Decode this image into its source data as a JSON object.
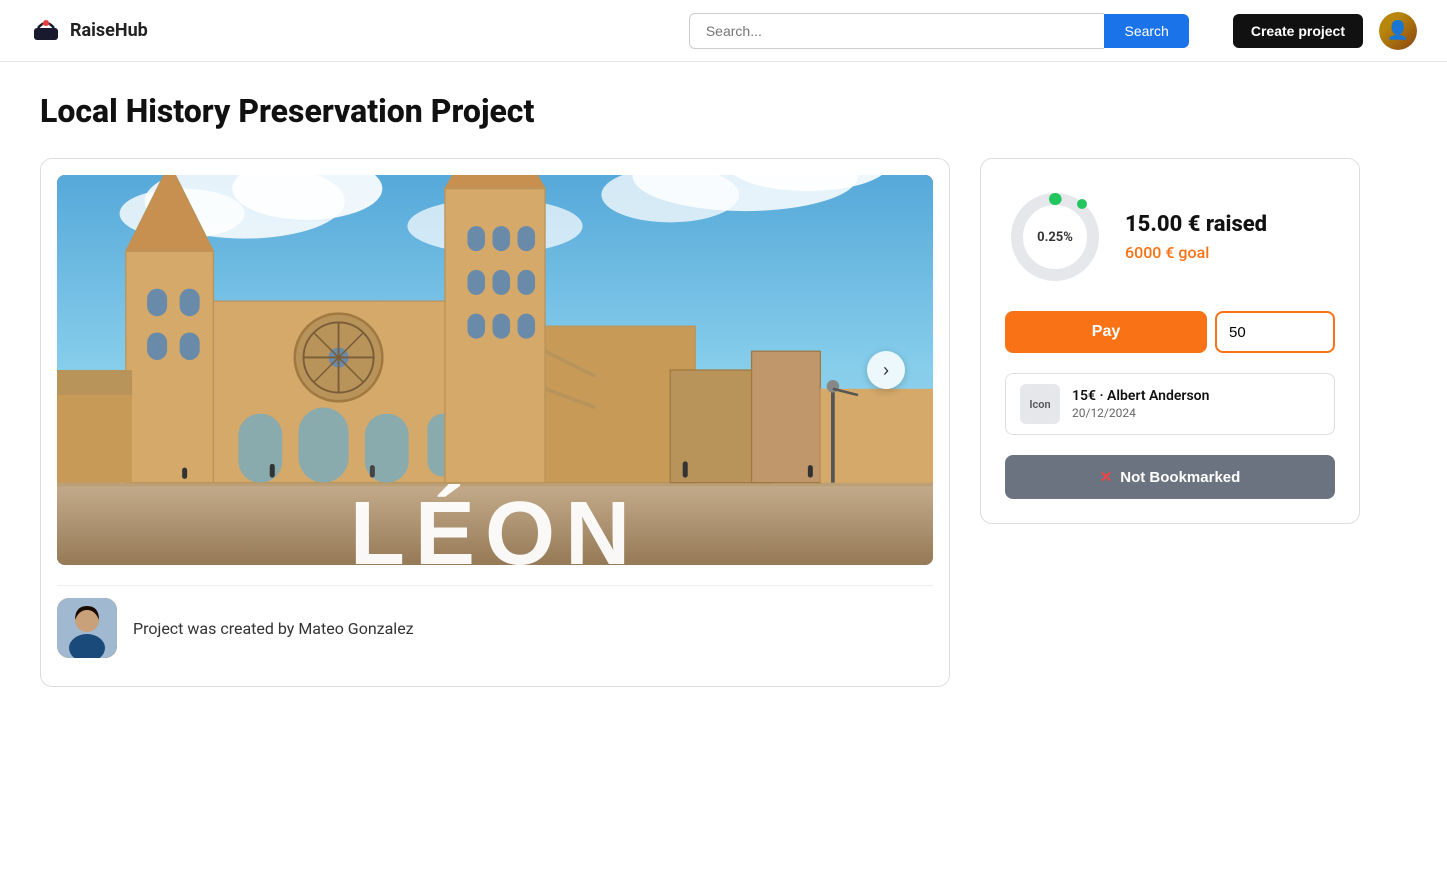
{
  "nav": {
    "logo_text": "RaiseHub",
    "search_placeholder": "Search...",
    "search_button": "Search",
    "create_button": "Create project"
  },
  "page": {
    "title": "Local History Preservation Project"
  },
  "funding": {
    "percentage": "0.25%",
    "raised": "15.00 € raised",
    "goal": "6000 € goal",
    "pay_button": "Pay",
    "amount_value": "50",
    "donation_icon": "Icon",
    "donation_name": "15€ · Albert Anderson",
    "donation_date": "20/12/2024"
  },
  "bookmark": {
    "label": "Not Bookmarked",
    "icon": "✕"
  },
  "image": {
    "overlay_text": "LEÓN"
  },
  "creator": {
    "text": "Project was created by Mateo Gonzalez"
  }
}
